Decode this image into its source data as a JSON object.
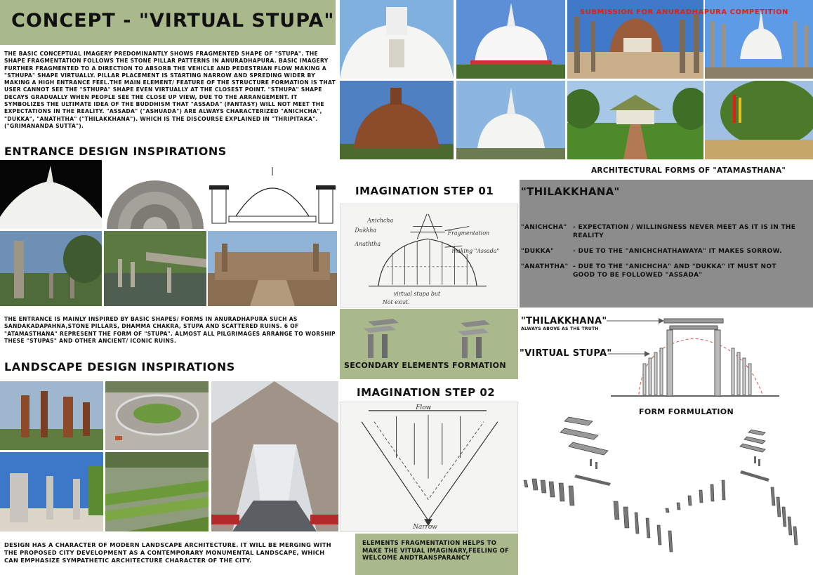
{
  "title": "CONCEPT - \"VIRTUAL STUPA\"",
  "concept_paragraph": "THE BASIC CONCEPTUAL IMAGERY PREDOMINANTLY SHOWS FRAGMENTED SHAPE OF \"STUPA\". THE SHAPE FRAGMENTATION FOLLOWS THE STONE PILLAR PATTERNS IN ANURADHAPURA. BASIC IMAGERY FURTHER FRAGMENTED TO A DIRECTION TO ABSORB THE VEHICLE AND PEDESTRIAN FLOW MAKING A \"STHUPA\" SHAPE VIRTUALLY. PILLAR PLACEMENT IS STARTING NARROW AND SPREDING WIDER BY MAKING A HIGH ENTRANCE FEEL.THE MAIN ELEMENT/ FEATURE OF THE STRUCTURE FORMATION IS THAT USER CANNOT SEE THE \"STHUPA\" SHAPE EVEN VIRTUALLY AT THE CLOSEST POINT. \"STHUPA\" SHAPE DECAYS GRADUALLY WHEN PEOPLE SEE THE CLOSE UP VIEW, DUE TO THE ARRANGEMENT. IT SYMBOLIZES THE ULTIMATE IDEA OF THE BUDDHISM THAT \"ASSADA\" (FANTASY) WILL NOT MEET THE EXPECTATIONS IN THE REALITY. \"ASSADA\" (\"ASHUADA\") ARE ALWAYS CHARACTERIZED \"ANICHCHA\", \"DUKKA\", \"ANATHTHA\" (\"THILAKKHANA\"). WHICH IS THE DISCOURSE EXPLAINED IN \"THRIPITAKA\". (\"GRIMANANDA SUTTA\").",
  "entrance_heading": "ENTRANCE DESIGN INSPIRATIONS",
  "entrance_paragraph": "THE ENTRANCE IS MAINLY INSPIRED BY BASIC SHAPES/ FORMS IN ANURADHAPURA SUCH AS SANDAKADAPAHNA,STONE PILLARS, DHAMMA CHAKRA, STUPA AND SCATTERED RUINS. 6 OF \"ATAMASTHANA\" REPRESENT THE FORM OF \"STUPA\". ALMOST ALL PILGRIMAGES ARRANGE TO WORSHIP THESE \"STUPAS\" AND OTHER ANCIENT/ ICONIC RUINS.",
  "landscape_heading": "LANDSCAPE DESIGN INSPIRATIONS",
  "landscape_paragraph": "DESIGN HAS A CHARACTER OF MODERN LANDSCAPE ARCHITECTURE. IT WILL BE MERGING WITH THE PROPOSED CITY DEVELOPMENT AS A CONTEMPORARY MONUMENTAL LANDSCAPE, WHICH CAN EMPHASIZE SYMPATHETIC ARCHITECTURE CHARACTER OF THE CITY.",
  "submission_label": "SUBMISSION FOR ANURADHAPURA COMPETITION",
  "atamasthana_caption": "ARCHITECTURAL FORMS OF \"ATAMASTHANA\"",
  "step1_heading": "IMAGINATION STEP 01",
  "step1_sketch": {
    "anichcha": "Anichcha",
    "dukkha": "Dukkha",
    "anaththa": "Anaththa",
    "fragmentation": "Fragmentation",
    "making": "making \"Assada\"",
    "virtual": "virtual stupa but",
    "not_exist": "Not exist."
  },
  "secondary_label": "SECONDARY ELEMENTS FORMATION",
  "step2_heading": "IMAGINATION STEP 02",
  "step2_sketch": {
    "flow": "Flow",
    "narrow": "Narrow"
  },
  "step2_caption": "ELEMENTS FRAGMENTATION HELPS TO MAKE THE VITUAL IMAGINARY,FEELING OF WELCOME ANDTRANSPARANCY",
  "thilakkhana_heading": "\"THILAKKHANA\"",
  "thilakkhana_items": [
    {
      "term": "\"ANICHCHA\"",
      "text": "- EXPECTATION / WILLINGNESS NEVER MEET AS IT IS IN THE REALITY"
    },
    {
      "term": "\"DUKKA\"",
      "text": "- DUE TO THE \"ANICHCHATHAWAYA\" IT MAKES SORROW."
    },
    {
      "term": "\"ANATHTHA\"",
      "text": "- DUE TO THE \"ANICHCHA\" AND \"DUKKA\" IT MUST NOT GOOD TO BE FOLLOWED \"ASSADA\""
    }
  ],
  "form": {
    "thilakkhana_label": "\"THILAKKHANA\"",
    "thilakkhana_sub": "ALWAYS ABOVE AS THE TRUTH",
    "virtual_label": "\"VIRTUAL STUPA\"",
    "formulation_label": "FORM FORMULATION"
  },
  "colors": {
    "panel_green": "#a9b98b",
    "panel_grey": "#8c8c8c",
    "accent_red": "#e0201a"
  }
}
